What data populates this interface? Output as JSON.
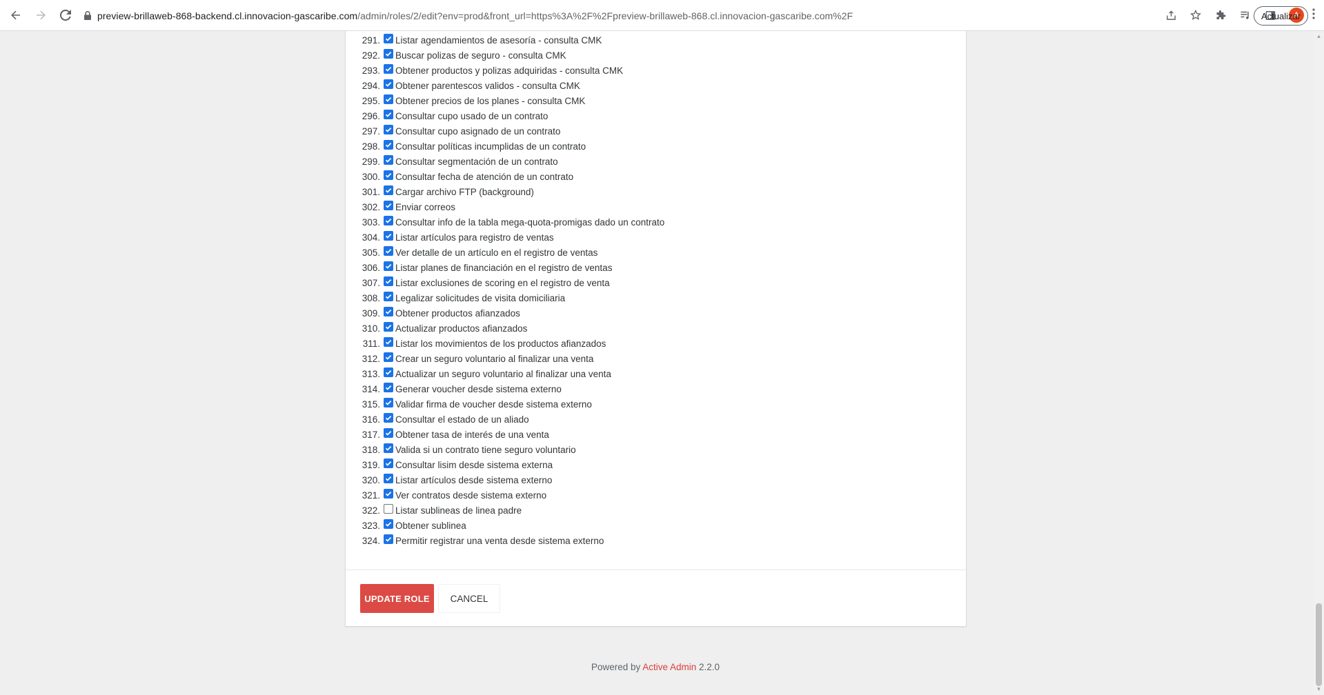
{
  "browser": {
    "url_host": "preview-brillaweb-868-backend.cl.innovacion-gascaribe.com",
    "url_path": "/admin/roles/2/edit?env=prod&front_url=https%3A%2F%2Fpreview-brillaweb-868.cl.innovacion-gascaribe.com%2F",
    "avatar_letter": "A",
    "update_label": "Actualizar"
  },
  "permissions": [
    {
      "num": "291.",
      "label": "Listar agendamientos de asesoría - consulta CMK",
      "checked": true
    },
    {
      "num": "292.",
      "label": "Buscar polizas de seguro - consulta CMK",
      "checked": true
    },
    {
      "num": "293.",
      "label": "Obtener productos y polizas adquiridas - consulta CMK",
      "checked": true
    },
    {
      "num": "294.",
      "label": "Obtener parentescos validos - consulta CMK",
      "checked": true
    },
    {
      "num": "295.",
      "label": "Obtener precios de los planes - consulta CMK",
      "checked": true
    },
    {
      "num": "296.",
      "label": "Consultar cupo usado de un contrato",
      "checked": true
    },
    {
      "num": "297.",
      "label": "Consultar cupo asignado de un contrato",
      "checked": true
    },
    {
      "num": "298.",
      "label": "Consultar políticas incumplidas de un contrato",
      "checked": true
    },
    {
      "num": "299.",
      "label": "Consultar segmentación de un contrato",
      "checked": true
    },
    {
      "num": "300.",
      "label": "Consultar fecha de atención de un contrato",
      "checked": true
    },
    {
      "num": "301.",
      "label": "Cargar archivo FTP (background)",
      "checked": true
    },
    {
      "num": "302.",
      "label": "Enviar correos",
      "checked": true
    },
    {
      "num": "303.",
      "label": "Consultar info de la tabla mega-quota-promigas dado un contrato",
      "checked": true
    },
    {
      "num": "304.",
      "label": "Listar artículos para registro de ventas",
      "checked": true
    },
    {
      "num": "305.",
      "label": "Ver detalle de un artículo en el registro de ventas",
      "checked": true
    },
    {
      "num": "306.",
      "label": "Listar planes de financiación en el registro de ventas",
      "checked": true
    },
    {
      "num": "307.",
      "label": "Listar exclusiones de scoring en el registro de venta",
      "checked": true
    },
    {
      "num": "308.",
      "label": "Legalizar solicitudes de visita domiciliaria",
      "checked": true
    },
    {
      "num": "309.",
      "label": "Obtener productos afianzados",
      "checked": true
    },
    {
      "num": "310.",
      "label": "Actualizar productos afianzados",
      "checked": true
    },
    {
      "num": "311.",
      "label": "Listar los movimientos de los productos afianzados",
      "checked": true
    },
    {
      "num": "312.",
      "label": "Crear un seguro voluntario al finalizar una venta",
      "checked": true
    },
    {
      "num": "313.",
      "label": "Actualizar un seguro voluntario al finalizar una venta",
      "checked": true
    },
    {
      "num": "314.",
      "label": "Generar voucher desde sistema externo",
      "checked": true
    },
    {
      "num": "315.",
      "label": "Validar firma de voucher desde sistema externo",
      "checked": true
    },
    {
      "num": "316.",
      "label": "Consultar el estado de un aliado",
      "checked": true
    },
    {
      "num": "317.",
      "label": "Obtener tasa de interés de una venta",
      "checked": true
    },
    {
      "num": "318.",
      "label": "Valida si un contrato tiene seguro voluntario",
      "checked": true
    },
    {
      "num": "319.",
      "label": "Consultar lisim desde sistema externa",
      "checked": true
    },
    {
      "num": "320.",
      "label": "Listar artículos desde sistema externo",
      "checked": true
    },
    {
      "num": "321.",
      "label": "Ver contratos desde sistema externo",
      "checked": true
    },
    {
      "num": "322.",
      "label": "Listar sublineas de linea padre",
      "checked": false
    },
    {
      "num": "323.",
      "label": "Obtener sublinea",
      "checked": true
    },
    {
      "num": "324.",
      "label": "Permitir registrar una venta desde sistema externo",
      "checked": true
    }
  ],
  "actions": {
    "update_label": "UPDATE ROLE",
    "cancel_label": "CANCEL"
  },
  "footer": {
    "prefix": "Powered by ",
    "link": "Active Admin",
    "version": " 2.2.0"
  },
  "colors": {
    "accent": "#dc4a45",
    "checkbox": "#1a73e8",
    "link": "#d93f3a"
  }
}
